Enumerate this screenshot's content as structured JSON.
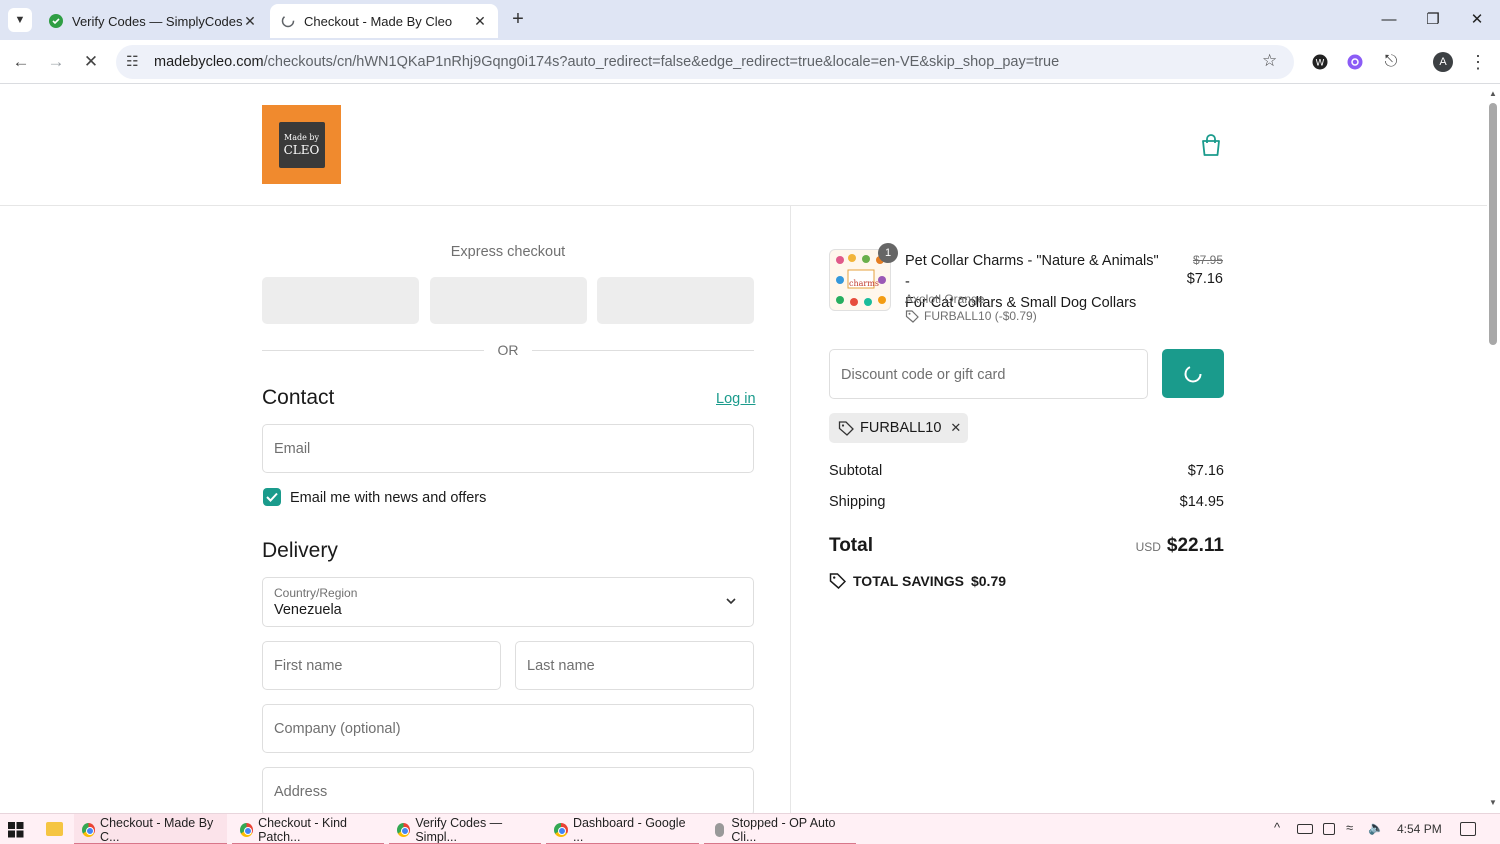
{
  "browser": {
    "tabs": [
      {
        "title": "Verify Codes — SimplyCodes",
        "active": false
      },
      {
        "title": "Checkout - Made By Cleo",
        "active": true
      }
    ],
    "url_domain": "madebycleo.com",
    "url_path": "/checkouts/cn/hWN1QKaP1nRhj9Gqng0i174s?auto_redirect=false&edge_redirect=true&locale=en-VE&skip_shop_pay=true",
    "profile_initial": "A"
  },
  "store": {
    "logo_line1": "Made by",
    "logo_line2": "CLEO"
  },
  "checkout": {
    "express_checkout_label": "Express checkout",
    "or_label": "OR",
    "contact_heading": "Contact",
    "login_link": "Log in",
    "email_placeholder": "Email",
    "newsletter_label": "Email me with news and offers",
    "newsletter_checked": true,
    "delivery_heading": "Delivery",
    "country_label": "Country/Region",
    "country_value": "Venezuela",
    "first_name_placeholder": "First name",
    "last_name_placeholder": "Last name",
    "company_placeholder": "Company (optional)",
    "address_placeholder": "Address"
  },
  "summary": {
    "item": {
      "quantity": "1",
      "name_line1": "Pet Collar Charms - \"Nature & Animals\" -",
      "name_line2": "For Cat Collars & Small Dog Collars",
      "variant": "Axolotl Orange",
      "discount": "FURBALL10 (-$0.79)",
      "original_price": "$7.95",
      "price": "$7.16",
      "thumb_text": "charms"
    },
    "discount_placeholder": "Discount code or gift card",
    "applied_code": "FURBALL10",
    "subtotal_label": "Subtotal",
    "subtotal_value": "$7.16",
    "shipping_label": "Shipping",
    "shipping_value": "$14.95",
    "total_label": "Total",
    "currency": "USD",
    "total_value": "$22.11",
    "savings_label": "TOTAL SAVINGS",
    "savings_value": "$0.79",
    "accent_color": "#1a9b8c"
  },
  "taskbar": {
    "items": [
      "Checkout - Made By C...",
      "Checkout - Kind Patch...",
      "Verify Codes — Simpl...",
      "Dashboard - Google ...",
      "Stopped - OP Auto Cli..."
    ],
    "time": "4:54 PM"
  }
}
